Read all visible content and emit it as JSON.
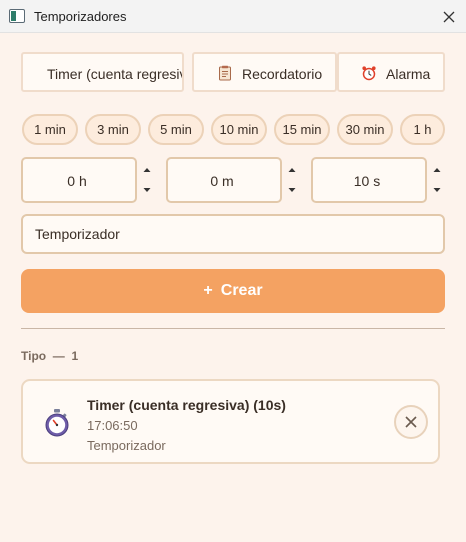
{
  "window": {
    "title": "Temporizadores"
  },
  "tabs": [
    {
      "label": "Timer (cuenta regresiva)",
      "icon": "stopwatch-icon"
    },
    {
      "label": "Recordatorio",
      "icon": "notepad-icon"
    },
    {
      "label": "Alarma",
      "icon": "alarm-clock-icon"
    }
  ],
  "presets": [
    "1 min",
    "3 min",
    "5 min",
    "10 min",
    "15 min",
    "30 min",
    "1 h"
  ],
  "duration": {
    "hours": "0 h",
    "minutes": "0 m",
    "seconds": "10 s"
  },
  "name_input": {
    "value": "Temporizador"
  },
  "create_button": {
    "label": "Crear",
    "icon": "+"
  },
  "list": {
    "header": "Tipo  —  1"
  },
  "timers": [
    {
      "title": "Timer (cuenta regresiva) (10s)",
      "time": "17:06:50",
      "name": "Temporizador",
      "icon": "stopwatch-icon"
    }
  ],
  "colors": {
    "accent": "#f4a262",
    "background": "#fdf3ec",
    "border": "#e2c8aa"
  }
}
